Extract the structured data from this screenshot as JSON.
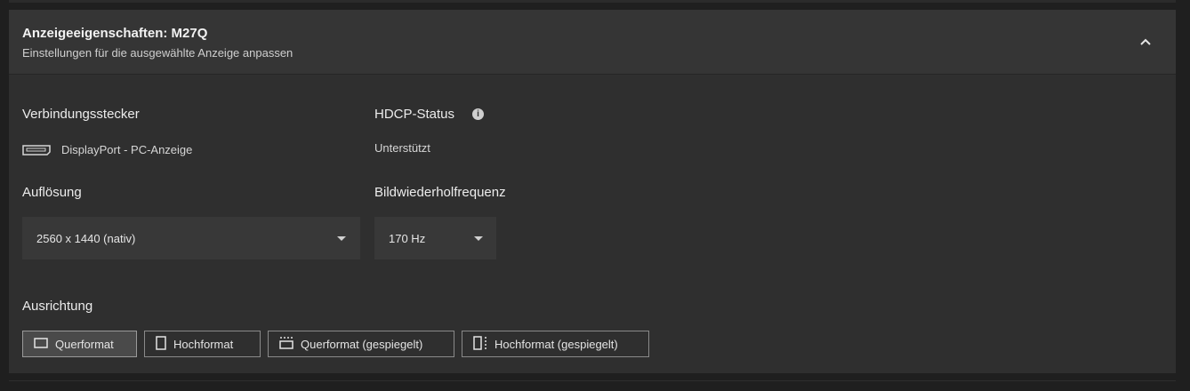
{
  "header": {
    "title": "Anzeigeeigenschaften: M27Q",
    "subtitle": "Einstellungen für die ausgewählte Anzeige anpassen",
    "collapse_icon": "chevron-up-icon"
  },
  "connector": {
    "label": "Verbindungsstecker",
    "icon": "displayport-icon",
    "value": "DisplayPort - PC-Anzeige"
  },
  "hdcp": {
    "label": "HDCP-Status",
    "info_icon": "info-icon",
    "value": "Unterstützt"
  },
  "resolution": {
    "label": "Auflösung",
    "selected": "2560 x 1440 (nativ)"
  },
  "refresh_rate": {
    "label": "Bildwiederholfrequenz",
    "selected": "170 Hz"
  },
  "orientation": {
    "label": "Ausrichtung",
    "selected_index": 0,
    "options": [
      {
        "label": "Querformat",
        "icon": "landscape-icon"
      },
      {
        "label": "Hochformat",
        "icon": "portrait-icon"
      },
      {
        "label": "Querformat (gespiegelt)",
        "icon": "landscape-flipped-icon"
      },
      {
        "label": "Hochformat (gespiegelt)",
        "icon": "portrait-flipped-icon"
      }
    ]
  }
}
